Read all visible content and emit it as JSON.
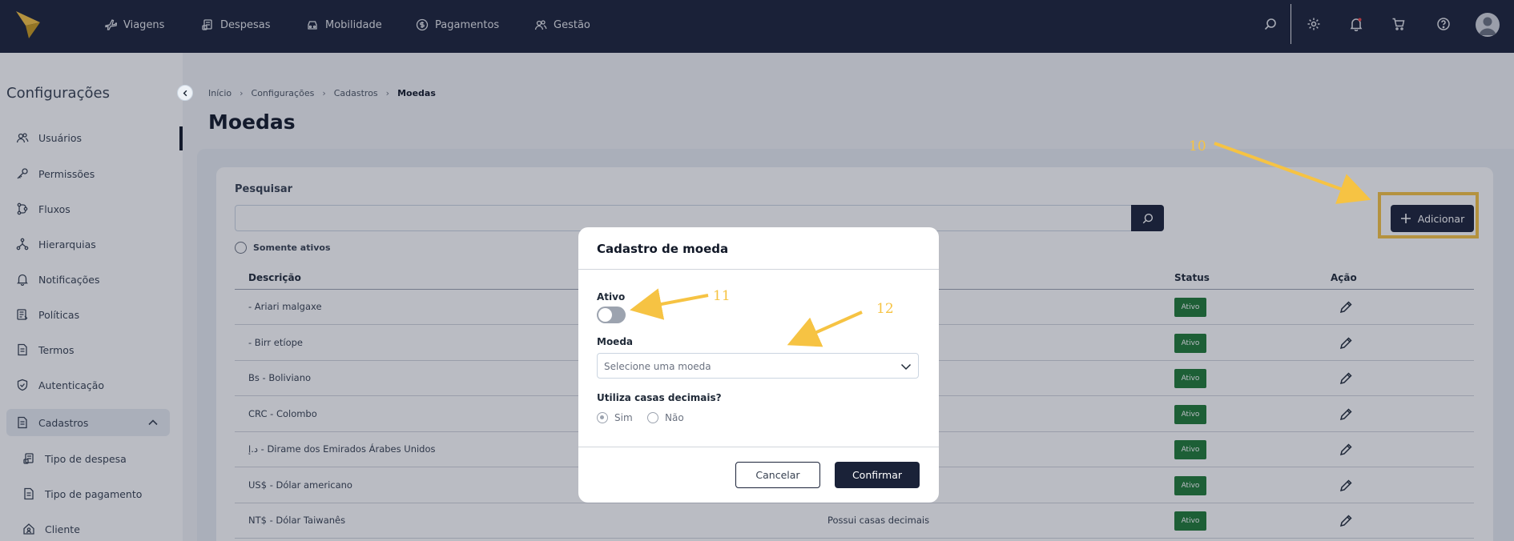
{
  "topnav": {
    "items": [
      {
        "label": "Viagens",
        "icon": "plane-icon"
      },
      {
        "label": "Despesas",
        "icon": "receipt-icon"
      },
      {
        "label": "Mobilidade",
        "icon": "car-icon"
      },
      {
        "label": "Pagamentos",
        "icon": "dollar-circle-icon"
      },
      {
        "label": "Gestão",
        "icon": "users-icon"
      }
    ],
    "right_icons": [
      "search-icon",
      "gear-icon",
      "bell-icon",
      "cart-icon",
      "help-icon",
      "avatar"
    ]
  },
  "sidebar": {
    "title": "Configurações",
    "items": [
      {
        "label": "Usuários",
        "icon": "users-icon"
      },
      {
        "label": "Permissões",
        "icon": "key-icon"
      },
      {
        "label": "Fluxos",
        "icon": "flow-icon"
      },
      {
        "label": "Hierarquias",
        "icon": "hierarchy-icon"
      },
      {
        "label": "Notificações",
        "icon": "bell-icon"
      },
      {
        "label": "Políticas",
        "icon": "policy-icon"
      },
      {
        "label": "Termos",
        "icon": "document-icon"
      },
      {
        "label": "Autenticação",
        "icon": "shield-icon"
      },
      {
        "label": "Cadastros",
        "icon": "document-icon"
      }
    ],
    "sub_items": [
      {
        "label": "Tipo de despesa",
        "icon": "receipt-icon"
      },
      {
        "label": "Tipo de pagamento",
        "icon": "document-icon"
      },
      {
        "label": "Cliente",
        "icon": "home-user-icon"
      }
    ]
  },
  "breadcrumb": [
    "Início",
    "Configurações",
    "Cadastros",
    "Moedas"
  ],
  "page": {
    "title": "Moedas",
    "search_label": "Pesquisar",
    "only_active_label": "Somente ativos",
    "add_button": "Adicionar"
  },
  "table": {
    "headers": {
      "description": "Descrição",
      "status": "Status",
      "action": "Ação"
    },
    "rows": [
      {
        "description": "- Ariari malgaxe",
        "decimals": "",
        "status": "Ativo"
      },
      {
        "description": "- Birr etíope",
        "decimals": "",
        "status": "Ativo"
      },
      {
        "description": "Bs - Boliviano",
        "decimals": "",
        "status": "Ativo"
      },
      {
        "description": "CRC - Colombo",
        "decimals": "",
        "status": "Ativo"
      },
      {
        "description": "د.إ - Dirame dos Emirados Árabes Unidos",
        "decimals": "",
        "status": "Ativo"
      },
      {
        "description": "US$ - Dólar americano",
        "decimals": "",
        "status": "Ativo"
      },
      {
        "description": "NT$ - Dólar Taiwanês",
        "decimals": "Possui casas decimais",
        "status": "Ativo"
      }
    ]
  },
  "modal": {
    "title": "Cadastro de moeda",
    "active_label": "Ativo",
    "active_on": false,
    "currency_label": "Moeda",
    "currency_placeholder": "Selecione uma moeda",
    "decimals_label": "Utiliza casas decimais?",
    "options": [
      "Sim",
      "Não"
    ],
    "selected_option": "Sim",
    "cancel": "Cancelar",
    "confirm": "Confirmar"
  },
  "annotations": {
    "a10": "10",
    "a11": "11",
    "a12": "12",
    "color": "#f6c343"
  },
  "colors": {
    "navy": "#1a2238",
    "status_green": "#1f7a36",
    "highlight": "#f6c343"
  }
}
